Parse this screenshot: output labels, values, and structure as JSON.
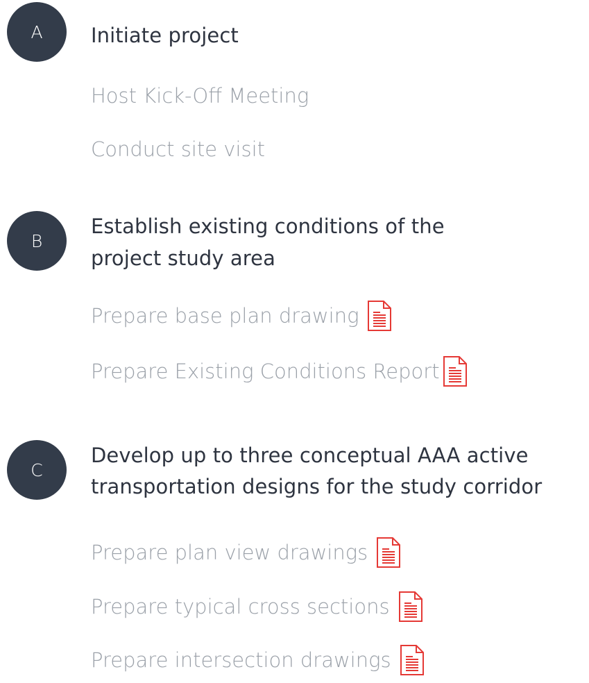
{
  "accent_color": "#333c4a",
  "doc_icon_color": "#e53935",
  "sections": [
    {
      "letter": "A",
      "title_lines": [
        "Initiate project"
      ],
      "tasks": [
        {
          "label": "Host Kick-Off Meeting",
          "has_doc": false
        },
        {
          "label": "Conduct site visit",
          "has_doc": false
        }
      ]
    },
    {
      "letter": "B",
      "title_lines": [
        "Establish existing conditions of the",
        "project study area"
      ],
      "tasks": [
        {
          "label": "Prepare base plan drawing",
          "has_doc": true,
          "doc_icon": "document-icon"
        },
        {
          "label": "Prepare Existing Conditions Report",
          "has_doc": true,
          "doc_icon": "document-icon"
        }
      ]
    },
    {
      "letter": "C",
      "title_lines": [
        "Develop up to three conceptual AAA active",
        "transportation designs for the study corridor"
      ],
      "tasks": [
        {
          "label": "Prepare plan view drawings",
          "has_doc": true,
          "doc_icon": "document-icon"
        },
        {
          "label": "Prepare typical cross sections",
          "has_doc": true,
          "doc_icon": "document-icon"
        },
        {
          "label": "Prepare intersection drawings",
          "has_doc": true,
          "doc_icon": "document-icon"
        }
      ]
    }
  ]
}
